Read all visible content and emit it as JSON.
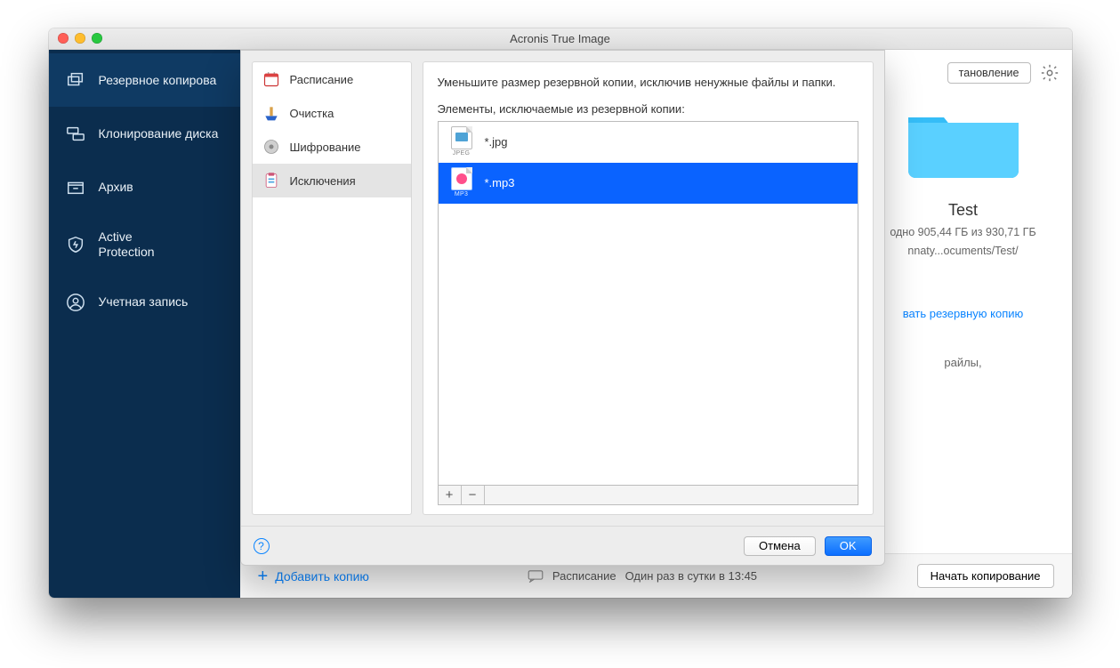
{
  "window": {
    "title": "Acronis True Image"
  },
  "sidebar": {
    "items": [
      {
        "label": "Резервное копирова"
      },
      {
        "label": "Клонирование диска"
      },
      {
        "label": "Архив"
      },
      {
        "label": "Active\nProtection"
      },
      {
        "label": "Учетная запись"
      }
    ]
  },
  "toolbar": {
    "restore_label": "тановление"
  },
  "destination": {
    "name": "Test",
    "free_line": "одно 905,44 ГБ из 930,71 ГБ",
    "path": "nnaty...ocuments/Test/",
    "link": "вать резервную копию",
    "greytext": "райлы,"
  },
  "bottom": {
    "add_copy": "Добавить копию",
    "schedule_label": "Расписание",
    "schedule_value": "Один раз в сутки в 13:45",
    "start_button": "Начать копирование"
  },
  "sheet": {
    "left": [
      {
        "label": "Расписание",
        "icon": "calendar"
      },
      {
        "label": "Очистка",
        "icon": "brush"
      },
      {
        "label": "Шифрование",
        "icon": "disc"
      },
      {
        "label": "Исключения",
        "icon": "clipboard"
      }
    ],
    "hint": "Уменьшите размер резервной копии, исключив ненужные файлы и папки.",
    "list_label": "Элементы, исключаемые из резервной копии:",
    "items": [
      {
        "pattern": "*.jpg",
        "caption": "JPEG",
        "color": "#4fa3d6"
      },
      {
        "pattern": "*.mp3",
        "caption": "MP3",
        "color": "#ff4f8b"
      }
    ],
    "cancel": "Отмена",
    "ok": "OK"
  }
}
